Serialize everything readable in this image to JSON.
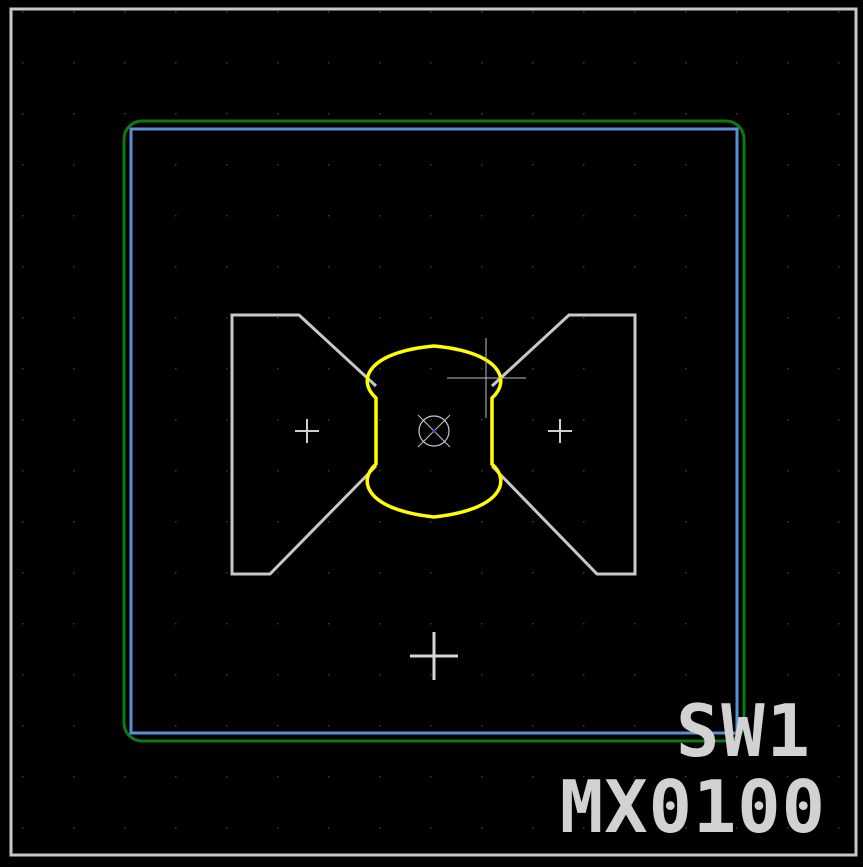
{
  "footprint": {
    "reference": "SW1",
    "value": "MX0100"
  },
  "colors": {
    "background": "#000000",
    "grid_dot": "#3a3a3a",
    "page_border": "#c8c8c8",
    "courtyard": "#0c7a0c",
    "fabrication": "#5a8fd6",
    "silkscreen_outline": "#c8c8c8",
    "pad_outline": "#ffff00",
    "crosshair": "#d0d0d0",
    "text": "#d2d2d2",
    "via_marker": "#c8c8c8"
  },
  "icons": {
    "cursor": "crosshair-cursor-icon",
    "origin": "anchor-cross-icon"
  }
}
